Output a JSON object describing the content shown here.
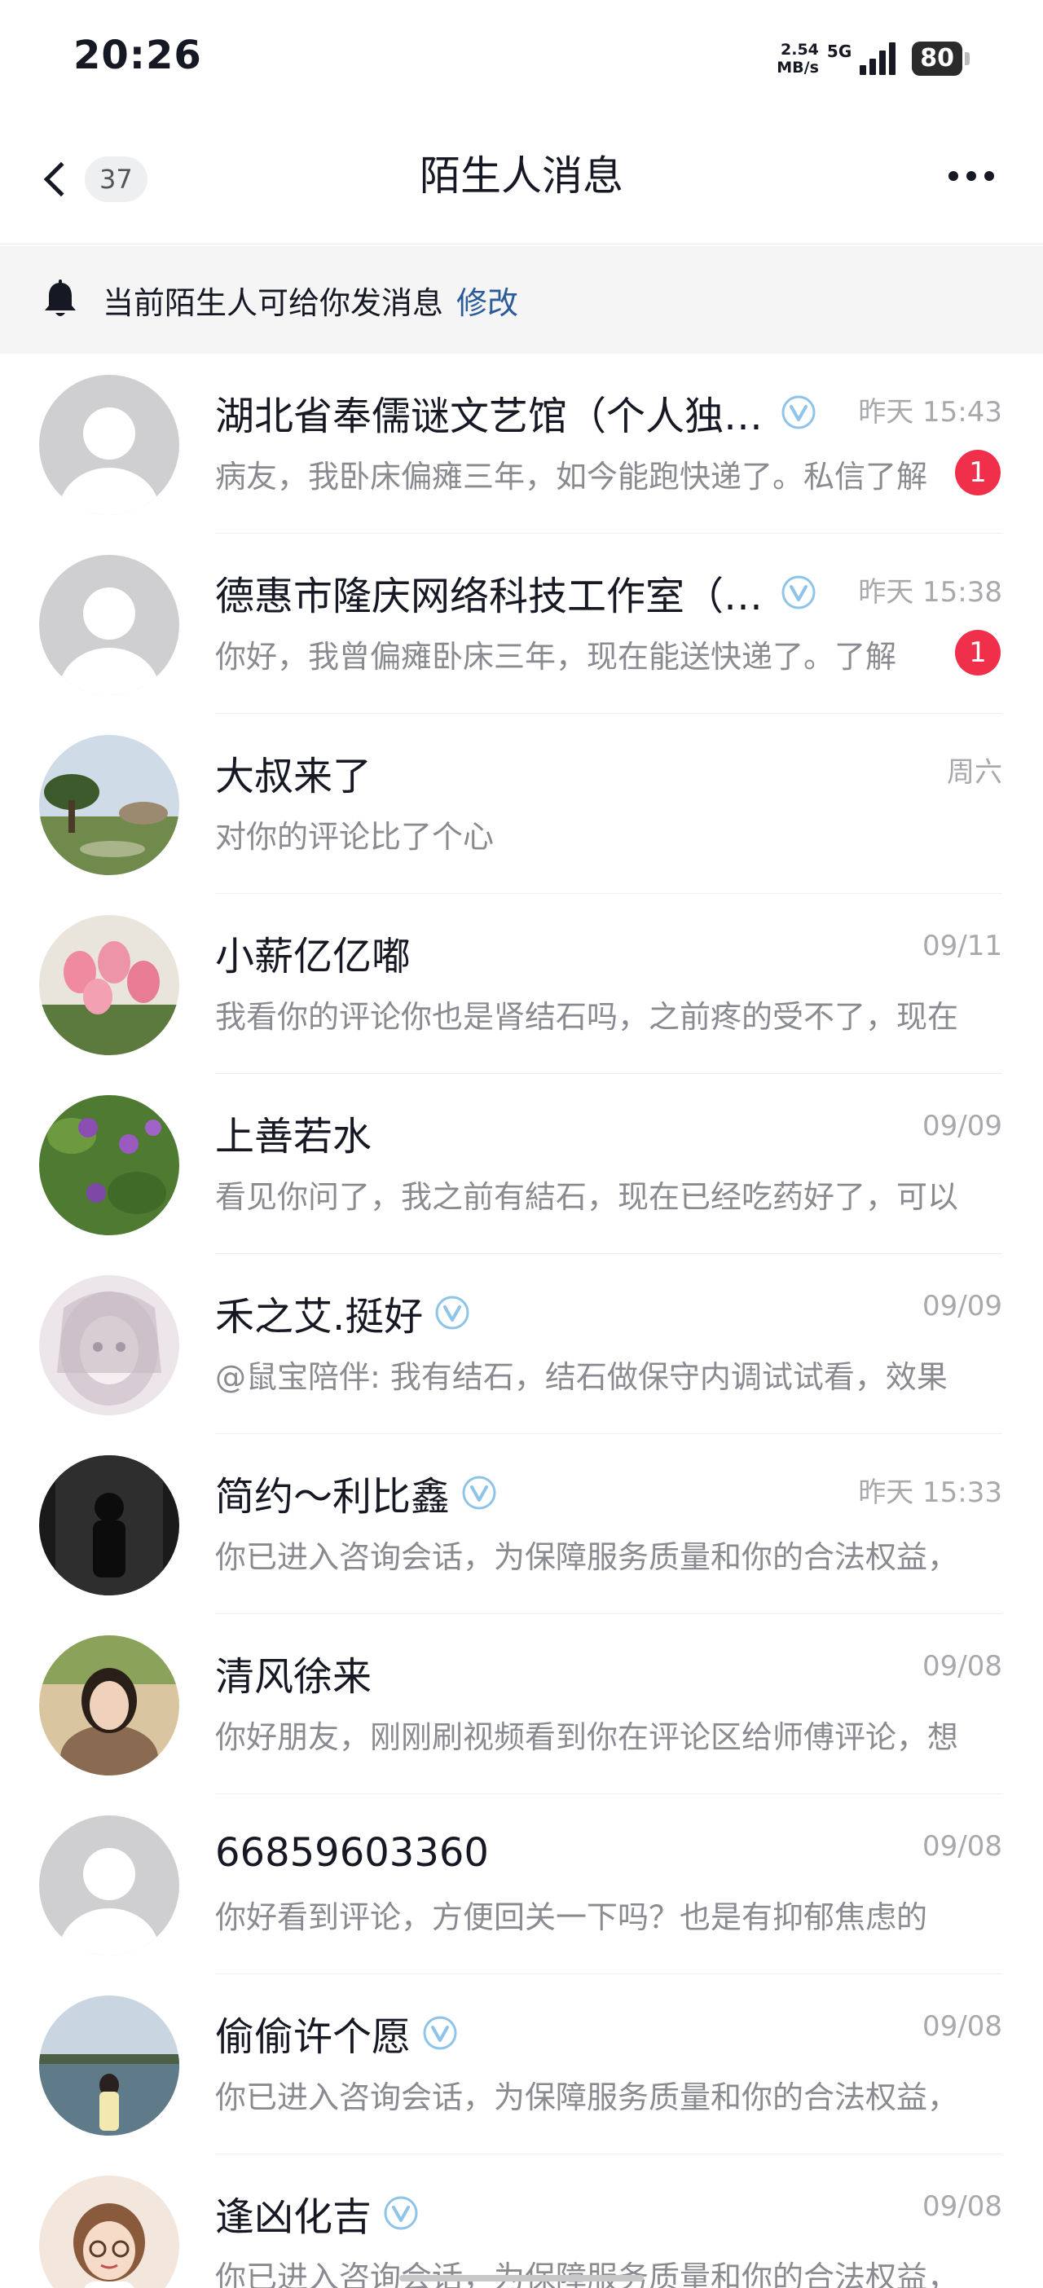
{
  "status_bar": {
    "time": "20:26",
    "net_speed_value": "2.54",
    "net_speed_unit": "MB/s",
    "network": "5G",
    "battery": "80"
  },
  "header": {
    "back_count": "37",
    "title": "陌生人消息",
    "more_icon": "more-dots-icon"
  },
  "notice": {
    "icon": "bell-icon",
    "text": "当前陌生人可给你发消息",
    "link": "修改"
  },
  "messages": [
    {
      "name": "湖北省奉儒谜文艺馆（个人独资）",
      "verified": true,
      "time": "昨天 15:43",
      "preview": "病友，我卧床偏瘫三年，如今能跑快递了。私信了解",
      "badge": "1",
      "avatar": "default"
    },
    {
      "name": "德惠市隆庆网络科技工作室（个人独资）",
      "verified": true,
      "time": "昨天 15:38",
      "preview": "你好，我曾偏瘫卧床三年，现在能送快递了。了解",
      "badge": "1",
      "avatar": "default"
    },
    {
      "name": "大叔来了",
      "verified": false,
      "time": "周六",
      "preview": "对你的评论比了个心",
      "badge": "",
      "avatar": "garden"
    },
    {
      "name": "小薪亿亿嘟",
      "verified": false,
      "time": "09/11",
      "preview": "我看你的评论你也是肾结石吗，之前疼的受不了，现在",
      "badge": "",
      "avatar": "tulips"
    },
    {
      "name": "上善若水",
      "verified": false,
      "time": "09/09",
      "preview": "看见你问了，我之前有結石，现在已经吃药好了，可以",
      "badge": "",
      "avatar": "flowers"
    },
    {
      "name": "禾之艾.挺好",
      "verified": true,
      "time": "09/09",
      "preview": "@鼠宝陪伴: 我有结石，结石做保守内调试试看，效果",
      "badge": "",
      "avatar": "anime"
    },
    {
      "name": "简约～利比鑫",
      "verified": true,
      "time": "昨天 15:33",
      "preview": "你已进入咨询会话，为保障服务质量和你的合法权益，",
      "badge": "",
      "avatar": "dark"
    },
    {
      "name": "清风徐来",
      "verified": false,
      "time": "09/08",
      "preview": "你好朋友，刚刚刷视频看到你在评论区给师傅评论，想",
      "badge": "",
      "avatar": "woman"
    },
    {
      "name": "66859603360",
      "verified": false,
      "time": "09/08",
      "preview": "你好看到评论，方便回关一下吗？也是有抑郁焦虑的",
      "badge": "",
      "avatar": "default"
    },
    {
      "name": "偷偷许个愿",
      "verified": true,
      "time": "09/08",
      "preview": "你已进入咨询会话，为保障服务质量和你的合法权益，",
      "badge": "",
      "avatar": "lake"
    },
    {
      "name": "逢凶化吉",
      "verified": true,
      "time": "09/08",
      "preview": "你已进入咨询会话，为保障服务质量和你的合法权益，",
      "badge": "",
      "avatar": "cartoon"
    }
  ],
  "colors": {
    "badge": "#f0304b",
    "link": "#2b5c9a",
    "verified": "#8fc4ea",
    "notice_bg": "#f5f5f6"
  }
}
